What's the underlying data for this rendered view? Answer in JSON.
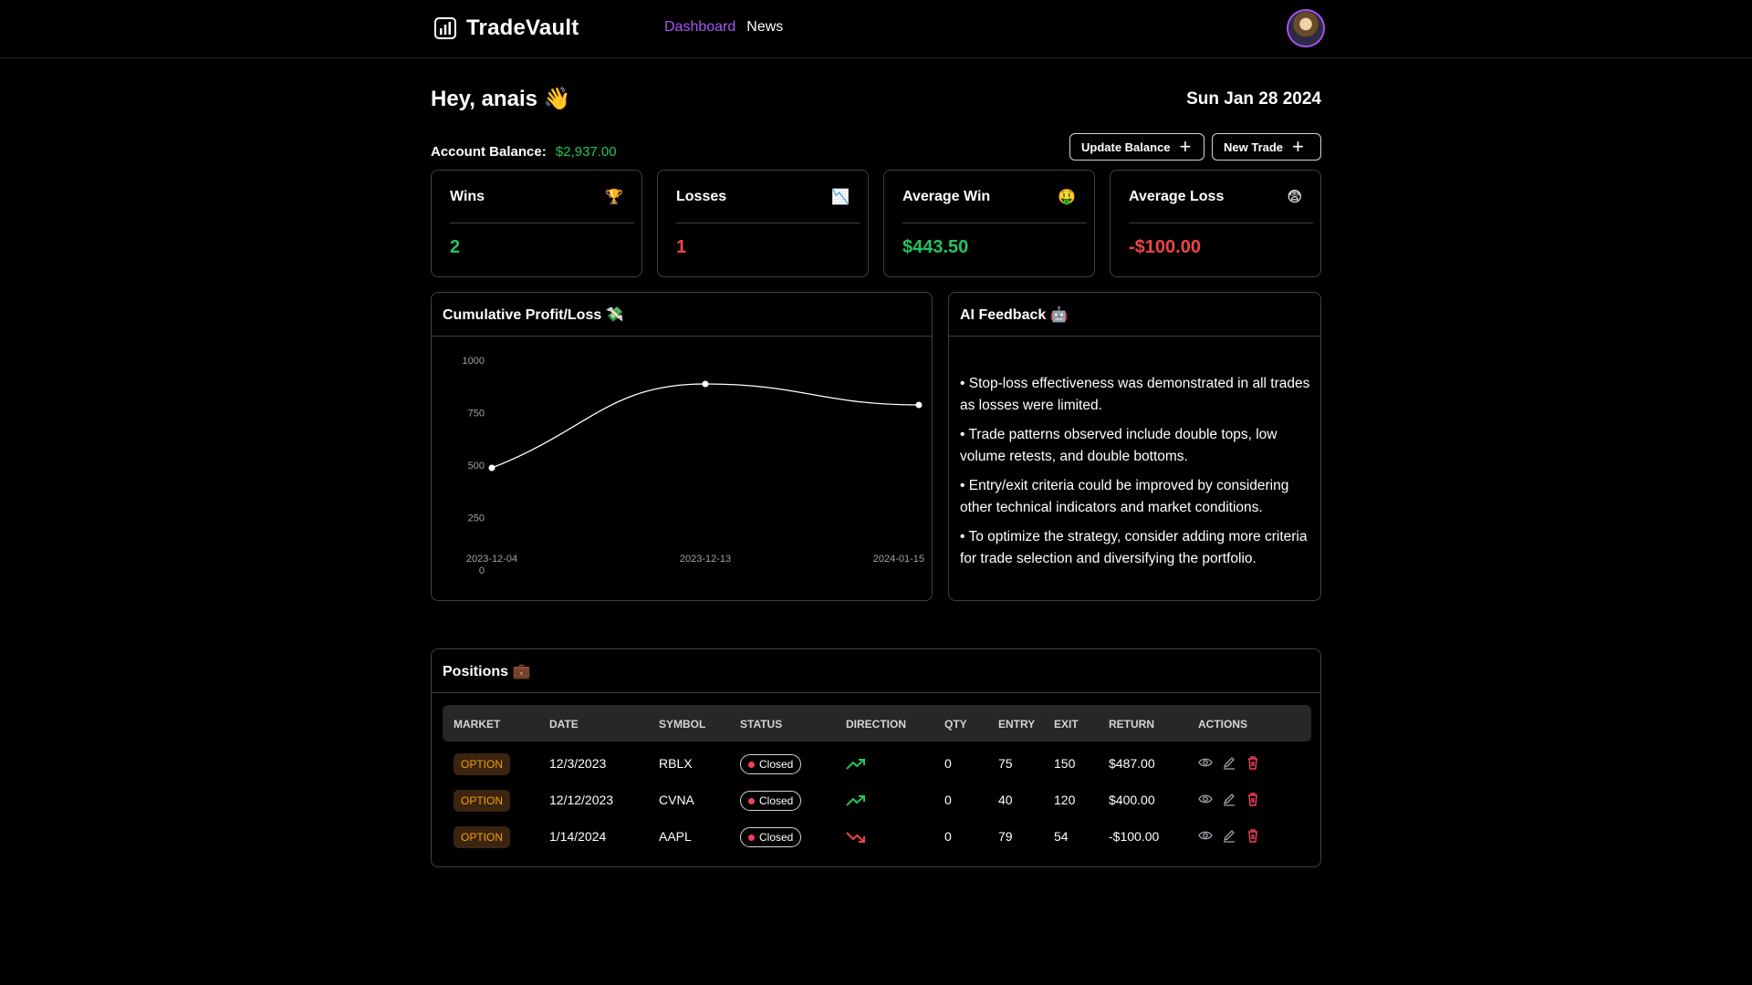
{
  "nav": {
    "brand": "TradeVault",
    "links": [
      "Dashboard",
      "News"
    ],
    "accent": "#a855f7"
  },
  "header": {
    "greeting": "Hey, anais 👋",
    "date": "Sun Jan 28 2024",
    "balance_label": "Account Balance:",
    "balance_value": "$2,937.00",
    "update_balance_label": "Update Balance",
    "new_trade_label": "New Trade"
  },
  "stats": [
    {
      "title": "Wins",
      "icon": "🏆",
      "value": "2",
      "color": "#22c55e"
    },
    {
      "title": "Losses",
      "icon": "📉",
      "value": "1",
      "color": "#ef4444"
    },
    {
      "title": "Average Win",
      "icon": "🤑",
      "value": "$443.50",
      "color": "#22c55e"
    },
    {
      "title": "Average Loss",
      "icon": "😨",
      "value": "-$100.00",
      "color": "#ef4444"
    }
  ],
  "chart_panel": {
    "title": "Cumulative Profit/Loss 💸"
  },
  "chart_data": {
    "type": "line",
    "x": [
      "2023-12-04",
      "2023-12-13",
      "2024-01-15"
    ],
    "values": [
      487,
      887,
      787
    ],
    "yticks": [
      0,
      250,
      500,
      750,
      1000
    ],
    "ylim": [
      0,
      1000
    ],
    "grid": false
  },
  "ai_panel": {
    "title": "AI Feedback 🤖",
    "items": [
      "• Stop-loss effectiveness was demonstrated in all trades as losses were limited.",
      "• Trade patterns observed include double tops, low volume retests, and double bottoms.",
      "• Entry/exit criteria could be improved by considering other technical indicators and market conditions.",
      "• To optimize the strategy, consider adding more criteria for trade selection and diversifying the portfolio."
    ]
  },
  "positions": {
    "title": "Positions 💼",
    "columns": [
      "MARKET",
      "DATE",
      "SYMBOL",
      "STATUS",
      "DIRECTION",
      "QTY",
      "ENTRY",
      "EXIT",
      "RETURN",
      "ACTIONS"
    ],
    "rows": [
      {
        "market": "OPTION",
        "date": "12/3/2023",
        "symbol": "RBLX",
        "status": "Closed",
        "direction": "up",
        "qty": "0",
        "entry": "75",
        "exit": "150",
        "return": "$487.00"
      },
      {
        "market": "OPTION",
        "date": "12/12/2023",
        "symbol": "CVNA",
        "status": "Closed",
        "direction": "up",
        "qty": "0",
        "entry": "40",
        "exit": "120",
        "return": "$400.00"
      },
      {
        "market": "OPTION",
        "date": "1/14/2024",
        "symbol": "AAPL",
        "status": "Closed",
        "direction": "down",
        "qty": "0",
        "entry": "79",
        "exit": "54",
        "return": "-$100.00"
      }
    ]
  }
}
